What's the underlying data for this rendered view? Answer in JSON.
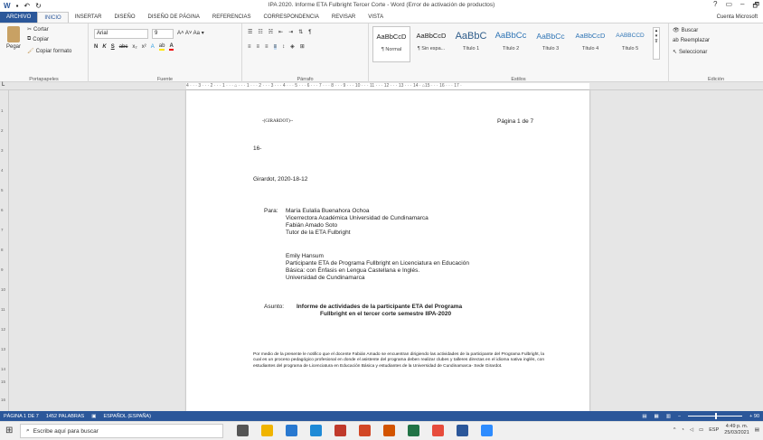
{
  "window": {
    "title": "IPA 2020. Informe ETA Fulbright Tercer Corte - Word (Error de activación de productos)",
    "controls": [
      "?",
      "▭",
      "–",
      "🗗"
    ]
  },
  "tabs": [
    "ARCHIVO",
    "INICIO",
    "INSERTAR",
    "DISEÑO",
    "DISEÑO DE PÁGINA",
    "REFERENCIAS",
    "CORRESPONDENCIA",
    "REVISAR",
    "VISTA"
  ],
  "account": "Cuenta Microsoft",
  "clipboard": {
    "paste": "Pegar",
    "cut": "Cortar",
    "copy": "Copiar",
    "format": "Copiar formato",
    "label": "Portapapeles"
  },
  "font": {
    "name": "Arial",
    "size": "9",
    "row1_extra": "A˄  A˅   Aa ▾",
    "bold": "N",
    "italic": "K",
    "underline": "S",
    "strike": "abc",
    "sub": "x₂",
    "sup": "x²",
    "label": "Fuente"
  },
  "paragraph": {
    "label": "Párrafo"
  },
  "styles": {
    "items": [
      {
        "sample": "AaBbCcD",
        "name": "¶ Normal"
      },
      {
        "sample": "AaBbCcD",
        "name": "¶ Sin espa..."
      },
      {
        "sample": "AaBbC",
        "name": "Título 1"
      },
      {
        "sample": "AaBbCc",
        "name": "Título 2"
      },
      {
        "sample": "AaBbCc",
        "name": "Título 3"
      },
      {
        "sample": "AaBbCcD",
        "name": "Título 4"
      },
      {
        "sample": "AABBCCD",
        "name": "Título 5"
      }
    ],
    "label": "Estilos"
  },
  "editing": {
    "find": "Buscar",
    "replace": "Reemplazar",
    "select": "Seleccionar",
    "label": "Edición"
  },
  "ruler_text": "4 · · · 3 · · · 2 · · · 1 · · · ⌂ · · · 1 · · · 2 · · · 3 · · · 4 · · · 5 · · · 6 · · · 7 · · · 8 · · · 9 · · · 10 · · · 11 · · · 12 · · · 13 · · · 14 · ⌂15 · · · 16 · · · 17 ·",
  "vruler": [
    "1",
    "2",
    "3",
    "4",
    "5",
    "6",
    "7",
    "8",
    "9",
    "10",
    "11",
    "12",
    "13",
    "14",
    "15",
    "16"
  ],
  "document": {
    "header_left": "-(GIRARDOT)--",
    "header_right": "Página 1 de 7",
    "ref": "16-",
    "date": "Girardot, 2020-18-12",
    "para_label": "Para:",
    "para_lines": [
      "María Eulalia Buenahora Ochoa",
      "Vicerrectora Académica Universidad de Cundinamarca",
      "Fabián Amado Soto",
      "Tutor de la ETA Fulbright"
    ],
    "emily_lines": [
      "Emily Hansum",
      "Participante ETA de Programa Fullbright en Licenciatura en Educación",
      "Básica: con Énfasis en Lengua Castellana e Inglés.",
      "Universidad de Cundinamarca"
    ],
    "asunto_label": "Asunto:",
    "asunto_line1": "Informe de actividades de la participante ETA del Programa",
    "asunto_line2": "Fullbright en el tercer corte semestre IIPA-2020",
    "body": "Por medio de la presente le notifico que el docente Fabián Amado se encuentran dirigiendo las actividades de la participante del Programa Fulbright, la cual es un proceso pedagógico profesional en donde el asistente del programa deben realizar clubes y talleres directas en el idioma nativa inglés, con estudiantes del programa de Licenciatura en Educación Básica y estudiantes de la Universidad de Cundinamarca- Sede Girardot."
  },
  "status": {
    "page": "PÁGINA 1 DE 7",
    "words": "1452 PALABRAS",
    "lang": "ESPAÑOL (ESPAÑA)",
    "zoom": "+ 90"
  },
  "taskbar": {
    "search_placeholder": "Escribe aquí para buscar",
    "lang": "ESP",
    "time": "4:49 p. m.",
    "date": "25/03/2021",
    "icon_colors": [
      "#555555",
      "#f0b400",
      "#2878d0",
      "#1e8ad6",
      "#c0392b",
      "#d24726",
      "#d35400",
      "#217346",
      "#e74c3c",
      "#2b579a",
      "#2d8cff"
    ]
  },
  "colors": {
    "accent": "#2b579a"
  }
}
